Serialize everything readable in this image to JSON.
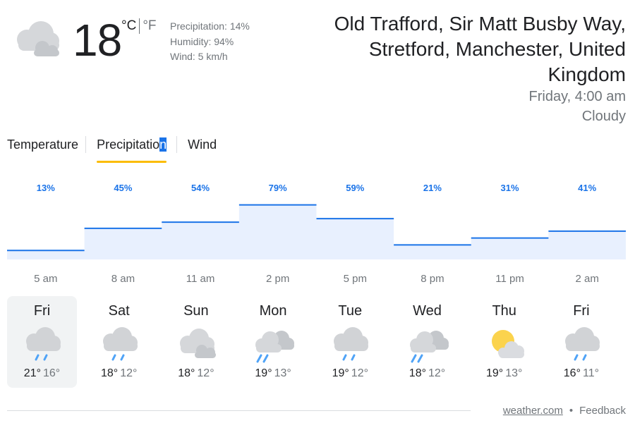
{
  "current": {
    "icon": "cloudy-icon",
    "temperature": "18",
    "unit_celsius": "°C",
    "unit_fahrenheit": "°F",
    "precipitation": "Precipitation: 14%",
    "humidity": "Humidity: 94%",
    "wind": "Wind: 5 km/h"
  },
  "location": {
    "name": "Old Trafford, Sir Matt Busby Way, Stretford, Manchester, United Kingdom",
    "datetime": "Friday, 4:00 am",
    "condition": "Cloudy"
  },
  "tabs": {
    "temperature": "Temperature",
    "precipitation_main": "Precipitatio",
    "precipitation_selected_char": "n",
    "wind": "Wind",
    "active": "Precipitation"
  },
  "chart_data": {
    "type": "area",
    "x": [
      "5 am",
      "8 am",
      "11 am",
      "2 pm",
      "5 pm",
      "8 pm",
      "11 pm",
      "2 am"
    ],
    "values": [
      13,
      45,
      54,
      79,
      59,
      21,
      31,
      41
    ],
    "value_suffix": "%",
    "ylim": [
      0,
      100
    ],
    "colors": {
      "line": "#1a73e8",
      "fill": "#e8f0fe",
      "label": "#1a73e8"
    },
    "grid": false
  },
  "days": [
    {
      "name": "Fri",
      "icon": "rain-cloud-icon",
      "high": "21°",
      "low": "16°",
      "selected": true
    },
    {
      "name": "Sat",
      "icon": "rain-cloud-icon",
      "high": "18°",
      "low": "12°",
      "selected": false
    },
    {
      "name": "Sun",
      "icon": "cloudy-icon",
      "high": "18°",
      "low": "12°",
      "selected": false
    },
    {
      "name": "Mon",
      "icon": "showers-icon",
      "high": "19°",
      "low": "13°",
      "selected": false
    },
    {
      "name": "Tue",
      "icon": "rain-cloud-icon",
      "high": "19°",
      "low": "12°",
      "selected": false
    },
    {
      "name": "Wed",
      "icon": "showers-icon",
      "high": "18°",
      "low": "12°",
      "selected": false
    },
    {
      "name": "Thu",
      "icon": "partly-cloudy-icon",
      "high": "19°",
      "low": "13°",
      "selected": false
    },
    {
      "name": "Fri",
      "icon": "rain-cloud-icon",
      "high": "16°",
      "low": "11°",
      "selected": false
    }
  ],
  "footer": {
    "source": "weather.com",
    "separator": "•",
    "feedback": "Feedback"
  }
}
